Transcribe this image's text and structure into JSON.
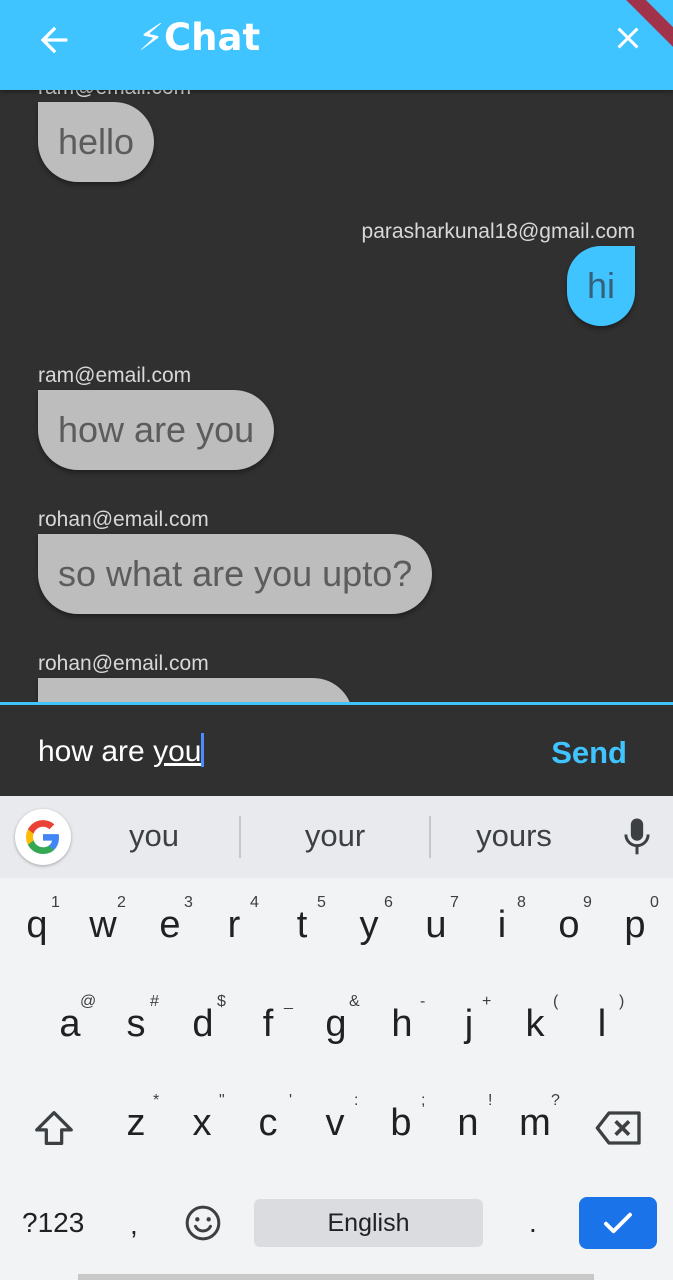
{
  "app_bar": {
    "title": "⚡Chat",
    "back_icon": "arrow-left-icon",
    "close_icon": "close-icon",
    "color": "#40c4ff"
  },
  "messages": [
    {
      "sender": "ram@email.com",
      "text": "hello",
      "outgoing": false
    },
    {
      "sender": "parasharkunal18@gmail.com",
      "text": "hi",
      "outgoing": true
    },
    {
      "sender": "ram@email.com",
      "text": "how are you",
      "outgoing": false
    },
    {
      "sender": "rohan@email.com",
      "text": "so what are you upto?",
      "outgoing": false
    },
    {
      "sender": "rohan@email.com",
      "text": "",
      "outgoing": false
    }
  ],
  "composer": {
    "value_prefix": "how are ",
    "value_word": "you",
    "send_label": "Send"
  },
  "keyboard": {
    "suggestions": [
      "you",
      "your",
      "yours"
    ],
    "row1": [
      "q",
      "w",
      "e",
      "r",
      "t",
      "y",
      "u",
      "i",
      "o",
      "p"
    ],
    "row1_hints": [
      "1",
      "2",
      "3",
      "4",
      "5",
      "6",
      "7",
      "8",
      "9",
      "0"
    ],
    "row2": [
      "a",
      "s",
      "d",
      "f",
      "g",
      "h",
      "j",
      "k",
      "l"
    ],
    "row2_hints": [
      "@",
      "#",
      "$",
      "_",
      "&",
      "-",
      "+",
      "(",
      ")"
    ],
    "row3": [
      "z",
      "x",
      "c",
      "v",
      "b",
      "n",
      "m"
    ],
    "row3_hints": [
      "*",
      "\"",
      "'",
      ":",
      ";",
      "!",
      "?"
    ],
    "symbols_label": "?123",
    "comma": ",",
    "space_label": "English",
    "period": ".",
    "accent": "#1a73e8"
  }
}
